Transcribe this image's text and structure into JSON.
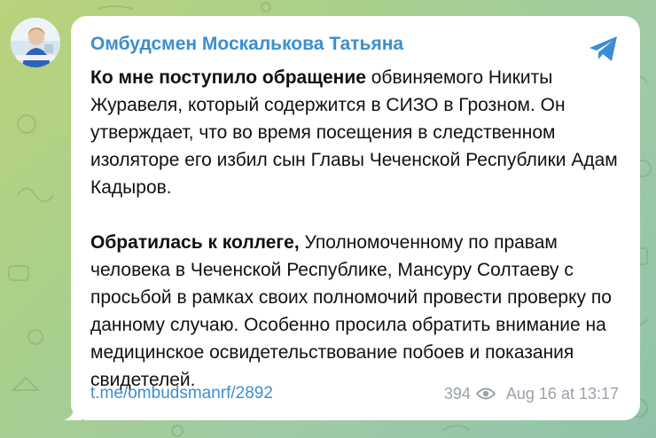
{
  "channel": {
    "name": "Омбудсмен Москалькова Татьяна",
    "avatar_icon": "channel-avatar"
  },
  "message": {
    "paragraph1_bold": "Ко мне поступило обращение",
    "paragraph1_rest": " обвиняемого Никиты Журавеля, который содержится в СИЗО в Грозном. Он утверждает, что во время посещения в следственном изоляторе его избил сын Главы Чеченской Республики Адам Кадыров.",
    "paragraph2_bold": "Обратилась к коллеге,",
    "paragraph2_rest": " Уполномоченному по правам человека в Чеченской Республике, Мансуру Солтаеву с просьбой в рамках своих полномочий провести проверку по данному случаю. Особенно просила обратить внимание на медицинское освидетельствование побоев и показания свидетелей."
  },
  "footer": {
    "link": "t.me/ombudsmanrf/2892",
    "views": "394",
    "timestamp": "Aug 16 at 13:17"
  },
  "icons": {
    "share": "telegram-share-icon",
    "views": "eye-icon"
  },
  "colors": {
    "accent": "#3a8fd1",
    "text": "#111111",
    "muted": "#9aa1a8",
    "bubble": "#ffffff",
    "background": "#a9cf8d"
  }
}
